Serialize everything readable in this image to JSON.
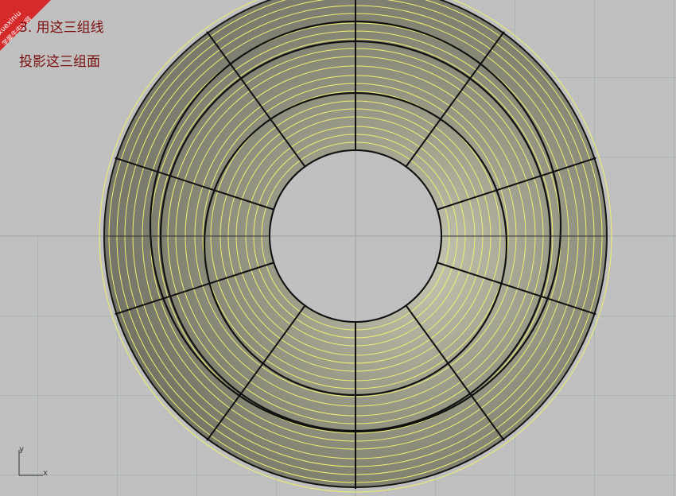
{
  "viewport": {
    "annotations": [
      "3. 用这三组线",
      "投影这三组面"
    ],
    "watermark": {
      "line1": "xuexiniu",
      "line2": "学犀牛中文网"
    },
    "axis": {
      "y": "y",
      "x": "x"
    },
    "colors": {
      "background": "#c0c0c0",
      "grid_minor": "#b8c0c0",
      "grid_major": "#8aa8a0",
      "surface": "#8e8e7c",
      "curves": "#f0f070",
      "edges": "#101010",
      "annotation": "#7a0e0e",
      "badge": "#d42a2a"
    }
  }
}
